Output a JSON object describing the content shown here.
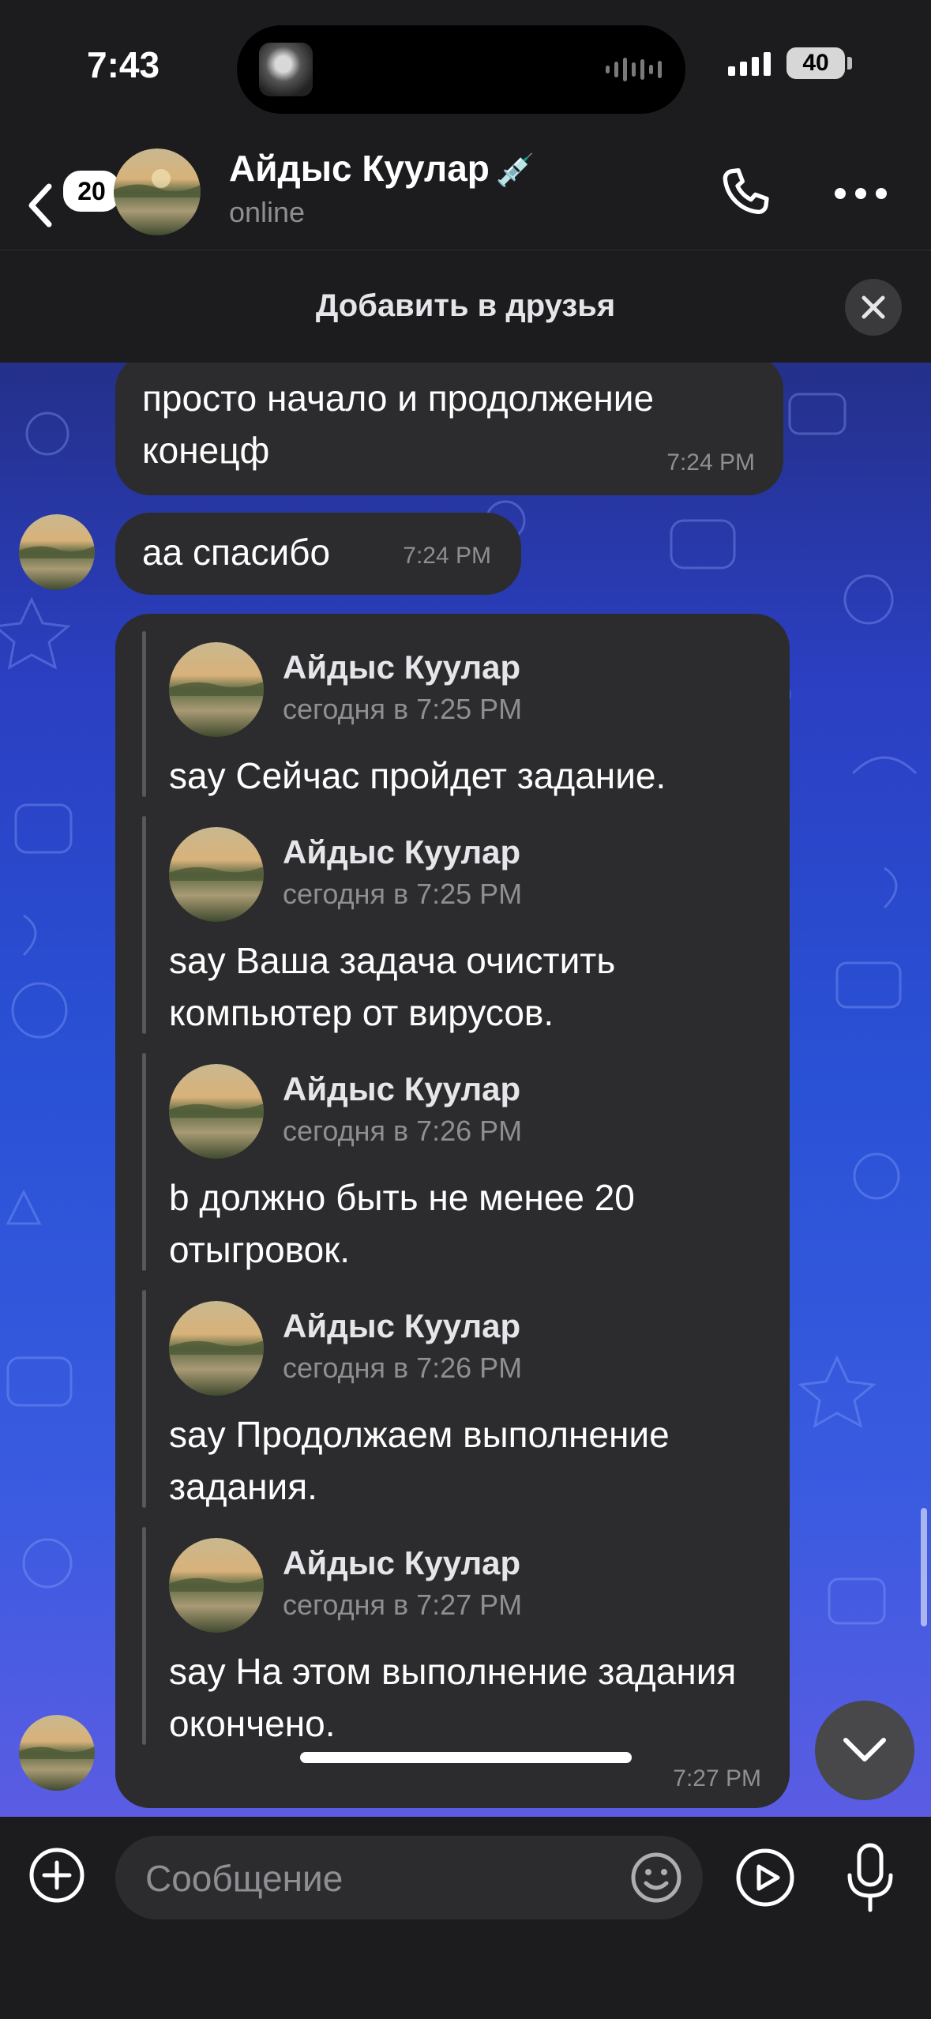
{
  "status_bar": {
    "time": "7:43",
    "battery": "40"
  },
  "header": {
    "back_badge": "20",
    "contact_name": "Айдыс Куулар",
    "name_emoji": "💉",
    "status": "online"
  },
  "add_friend": {
    "label": "Добавить в друзья"
  },
  "messages": [
    {
      "text": "просто начало и продолжение конецф",
      "time": "7:24 PM"
    },
    {
      "text": "аа спасибо",
      "time": "7:24 PM"
    }
  ],
  "forwarded": {
    "time": "7:27 PM",
    "items": [
      {
        "name": "Айдыс Куулар",
        "date": "сегодня в 7:25 PM",
        "text": "say Сейчас пройдет задание."
      },
      {
        "name": "Айдыс Куулар",
        "date": "сегодня в 7:25 PM",
        "text": "say Ваша задача очистить компьютер от вирусов."
      },
      {
        "name": "Айдыс Куулар",
        "date": "сегодня в 7:26 PM",
        "text": "b должно быть не менее 20 отыгровок."
      },
      {
        "name": "Айдыс Куулар",
        "date": "сегодня в 7:26 PM",
        "text": "say Продолжаем выполнение задания."
      },
      {
        "name": "Айдыс Куулар",
        "date": "сегодня в 7:27 PM",
        "text": "say На этом выполнение задания окончено."
      }
    ]
  },
  "input": {
    "placeholder": "Сообщение"
  },
  "icons": {
    "back": "chevron-left-icon",
    "call": "phone-icon",
    "more": "more-horizontal-icon",
    "close": "close-icon",
    "scroll_down": "chevron-down-icon",
    "attach": "plus-circle-icon",
    "emoji": "smile-icon",
    "video_message": "play-circle-icon",
    "mic": "microphone-icon"
  },
  "colors": {
    "background": "#1c1c1e",
    "bubble": "#2c2c2e",
    "secondary_text": "#8e8e93",
    "chat_bg_top": "#243089",
    "chat_bg_bottom": "#5b5ce3"
  }
}
